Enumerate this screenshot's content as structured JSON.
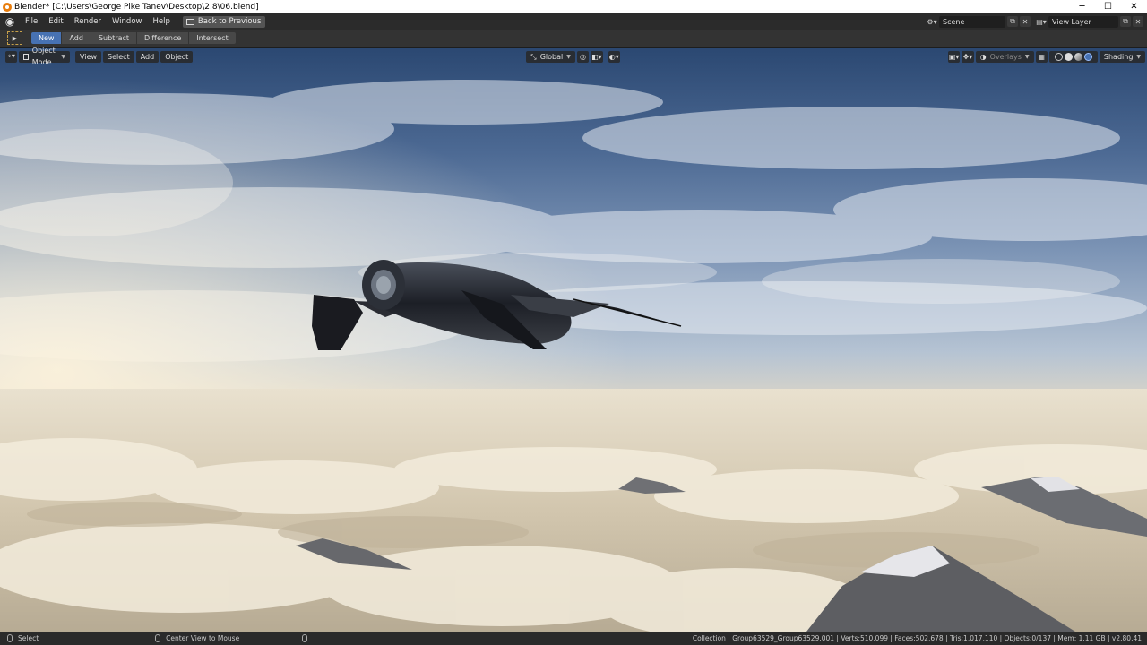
{
  "window": {
    "title": "Blender* [C:\\Users\\George Pike Tanev\\Desktop\\2.8\\06.blend]",
    "controls": {
      "minimize": "─",
      "maximize": "☐",
      "close": "✕"
    }
  },
  "menubar": {
    "items": [
      "File",
      "Edit",
      "Render",
      "Window",
      "Help"
    ],
    "back_button": "Back to Previous",
    "scene": {
      "label": "Scene"
    },
    "view_layer": {
      "label": "View Layer"
    }
  },
  "tool_header": {
    "boolean_modes": [
      "New",
      "Add",
      "Subtract",
      "Difference",
      "Intersect"
    ],
    "active_mode": "New"
  },
  "viewport_header": {
    "mode": "Object Mode",
    "menus": [
      "View",
      "Select",
      "Add",
      "Object"
    ],
    "orientation": "Global",
    "overlays": "Overlays",
    "shading": "Shading"
  },
  "statusbar": {
    "left_action": "Select",
    "middle_action": "Center View to Mouse",
    "stats": "Collection | Group63529_Group63529.001 | Verts:510,099 | Faces:502,678 | Tris:1,017,110 | Objects:0/137 | Mem: 1.11 GB | v2.80.41"
  },
  "colors": {
    "accent": "#4772b3",
    "header_bg": "#333333",
    "menubar_bg": "#2b2b2b"
  },
  "icons": {
    "app": "blender-icon",
    "tool": "select-box-icon",
    "editor_type": "3d-viewport-icon"
  }
}
